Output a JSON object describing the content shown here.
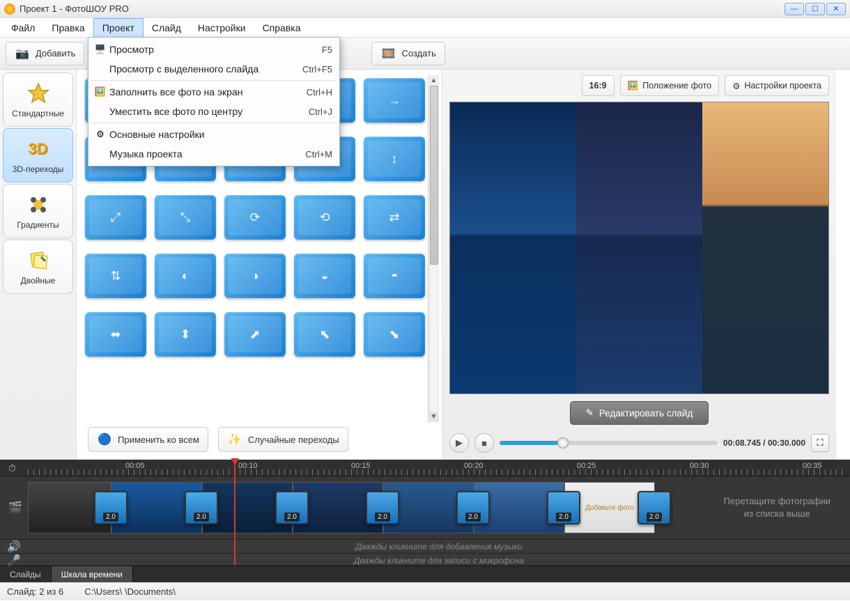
{
  "titlebar": {
    "title": "Проект 1 - ФотоШОУ PRO"
  },
  "menus": [
    "Файл",
    "Правка",
    "Проект",
    "Слайд",
    "Настройки",
    "Справка"
  ],
  "active_menu_index": 2,
  "dropdown": [
    {
      "icon": "monitor",
      "label": "Просмотр",
      "shortcut": "F5"
    },
    {
      "icon": "",
      "label": "Просмотр с выделенного слайда",
      "shortcut": "Ctrl+F5"
    },
    {
      "sep": true
    },
    {
      "icon": "fill",
      "label": "Заполнить все фото на экран",
      "shortcut": "Ctrl+H"
    },
    {
      "icon": "",
      "label": "Уместить все фото по центру",
      "shortcut": "Ctrl+J"
    },
    {
      "sep": true
    },
    {
      "icon": "gear",
      "label": "Основные настройки",
      "shortcut": ""
    },
    {
      "icon": "",
      "label": "Музыка проекта",
      "shortcut": "Ctrl+M"
    }
  ],
  "toolbar": {
    "add": "Добавить",
    "create": "Создать"
  },
  "categories": [
    {
      "key": "standard",
      "label": "Стандартные"
    },
    {
      "key": "3d",
      "label": "3D-переходы"
    },
    {
      "key": "gradients",
      "label": "Градиенты"
    },
    {
      "key": "double",
      "label": "Двойные"
    }
  ],
  "active_category_index": 1,
  "trans_actions": {
    "apply_all": "Применить ко всем",
    "random": "Случайные переходы"
  },
  "preview": {
    "aspect": "16:9",
    "photo_position": "Положение фото",
    "project_settings": "Настройки проекта",
    "edit_slide": "Редактировать слайд",
    "time_current": "00:08.745",
    "time_total": "00:30.000",
    "progress_pct": 29
  },
  "timeline": {
    "ticks": [
      "00:05",
      "00:10",
      "00:15",
      "00:20",
      "00:25",
      "00:30",
      "00:35"
    ],
    "playhead_pct": 26,
    "transition_duration": "2.0",
    "hint_line1": "Перетащите фотографии",
    "hint_line2": "из списка выше",
    "add_photo_label": "Добавьте фото",
    "audio_hint": "Дважды кликните для добавления музыки",
    "mic_hint": "Дважды кликните для записи с микрофона"
  },
  "bottom_tabs": {
    "slides": "Слайды",
    "timeline": "Шкала времени",
    "active": 1
  },
  "status": {
    "slide": "Слайд: 2 из 6",
    "path": "C:\\Users\\            \\Documents\\"
  }
}
